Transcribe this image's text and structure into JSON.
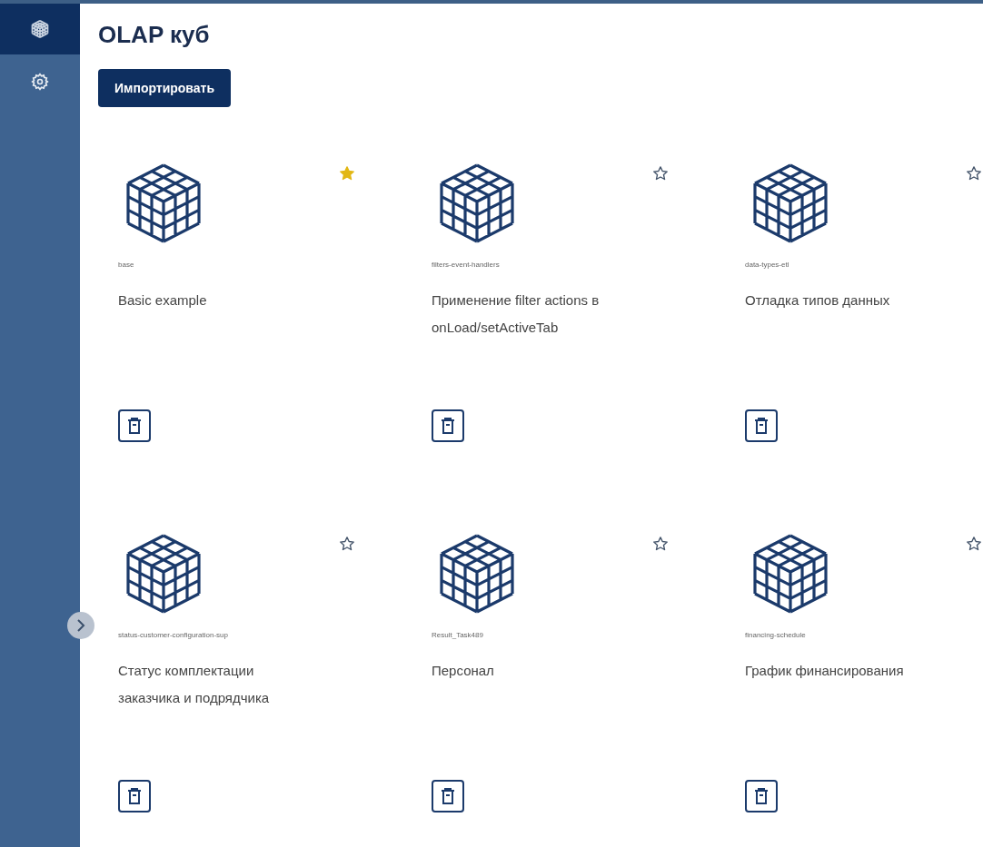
{
  "nav": [
    {
      "kind": "cube",
      "selected": true
    },
    {
      "kind": "gear",
      "selected": false
    }
  ],
  "page": {
    "title": "OLAP куб",
    "import_button": "Импортировать"
  },
  "cards": [
    {
      "code": "base",
      "title": "Basic example",
      "favorite": true
    },
    {
      "code": "filters-event-handlers",
      "title": "Применение filter actions в onLoad/setActiveTab",
      "favorite": false
    },
    {
      "code": "data-types-etl",
      "title": "Отладка типов данных",
      "favorite": false
    },
    {
      "code": "status-customer-configuration-sup",
      "title": "Статус комплектации заказчика и подрядчика",
      "favorite": false
    },
    {
      "code": "Result_Task489",
      "title": "Персонал",
      "favorite": false
    },
    {
      "code": "financing-schedule",
      "title": "График финансирования",
      "favorite": false
    }
  ],
  "sidebar": {
    "expanded": false
  }
}
